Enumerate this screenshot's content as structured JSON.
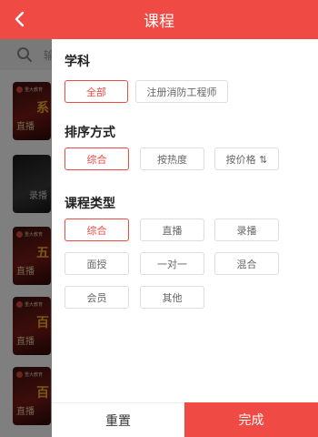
{
  "header": {
    "title": "课程"
  },
  "background": {
    "search_hint": "输",
    "items": [
      {
        "logo": "重大教育",
        "big": "系",
        "small": "直播"
      },
      {
        "logo": "",
        "big": "",
        "small": "录播"
      },
      {
        "logo": "重大教育",
        "big": "五",
        "small": "直播"
      },
      {
        "logo": "重大教育",
        "big": "百",
        "small": "直播"
      },
      {
        "logo": "重大教育",
        "big": "百",
        "small": "直播"
      }
    ]
  },
  "filter": {
    "subject": {
      "title": "学科",
      "options": [
        "全部",
        "注册消防工程师"
      ],
      "selected": "全部"
    },
    "sort": {
      "title": "排序方式",
      "options": [
        "综合",
        "按热度",
        "按价格 ⇅"
      ],
      "selected": "综合"
    },
    "course_type": {
      "title": "课程类型",
      "options": [
        "综合",
        "直播",
        "录播",
        "面授",
        "一对一",
        "混合",
        "会员",
        "其他"
      ],
      "selected": "综合"
    }
  },
  "footer": {
    "reset_label": "重置",
    "done_label": "完成"
  },
  "colors": {
    "accent": "#ef4a43",
    "tag_border": "#dddddd",
    "tag_text": "#666666"
  }
}
